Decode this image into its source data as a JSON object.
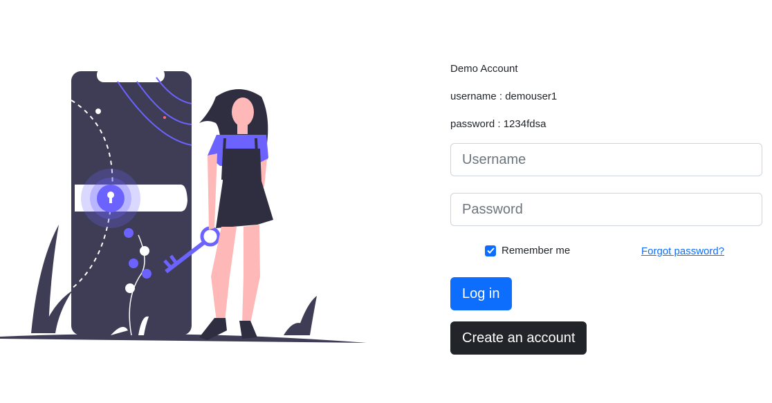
{
  "demo": {
    "heading": "Demo Account",
    "username_line": "username : demouser1",
    "password_line": "password : 1234fdsa"
  },
  "form": {
    "username_placeholder": "Username",
    "username_value": "",
    "password_placeholder": "Password",
    "password_value": "",
    "remember_label": "Remember me",
    "remember_checked": true,
    "forgot_label": "Forgot password?",
    "login_label": "Log in",
    "create_label": "Create an account"
  },
  "colors": {
    "accent": "#6c63ff",
    "dark": "#3f3d56",
    "primary": "#0d6efd",
    "skin": "#ffb8b8"
  }
}
